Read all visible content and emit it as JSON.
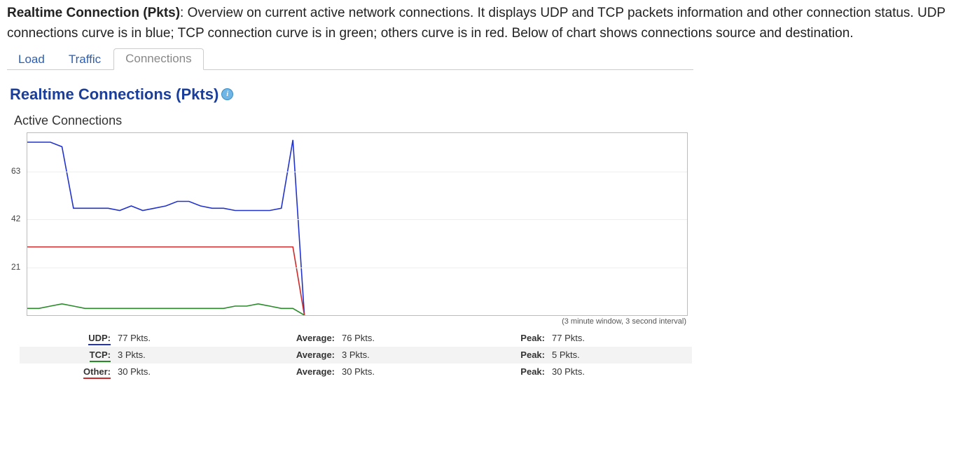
{
  "intro_bold": "Realtime Connection (Pkts)",
  "intro_rest": ": Overview on current active network connections. It displays UDP and TCP packets information and other connection status. UDP connections curve is in blue; TCP connection curve is in green; others curve is in red. Below of chart shows connections source and destination.",
  "tabs": {
    "load": "Load",
    "traffic": "Traffic",
    "connections": "Connections"
  },
  "section_title": "Realtime Connections (Pkts)",
  "sub_title": "Active Connections",
  "chart_note": "(3 minute window, 3 second interval)",
  "yticks": {
    "t1": "21",
    "t2": "42",
    "t3": "63"
  },
  "stats": {
    "avg_label": "Average:",
    "peak_label": "Peak:",
    "rows": [
      {
        "name": "UDP:",
        "color": "#2233cc",
        "cur": "77 Pkts.",
        "avg": "76 Pkts.",
        "peak": "77 Pkts."
      },
      {
        "name": "TCP:",
        "color": "#2a8a2a",
        "cur": "3 Pkts.",
        "avg": "3 Pkts.",
        "peak": "5 Pkts."
      },
      {
        "name": "Other:",
        "color": "#cc2a2a",
        "cur": "30 Pkts.",
        "avg": "30 Pkts.",
        "peak": "30 Pkts."
      }
    ]
  },
  "chart_data": {
    "type": "line",
    "x_description": "time (3-minute window, 3-second interval)",
    "ylabel": "Active Connections (Pkts)",
    "ylim": [
      0,
      80
    ],
    "yticks": [
      21,
      42,
      63
    ],
    "x": [
      0,
      1,
      2,
      3,
      4,
      5,
      6,
      7,
      8,
      9,
      10,
      11,
      12,
      13,
      14,
      15,
      16,
      17,
      18,
      19,
      20,
      21,
      22,
      23,
      24
    ],
    "visible_extent_fraction": 0.42,
    "series": [
      {
        "name": "UDP",
        "color": "#2233cc",
        "values": [
          76,
          76,
          76,
          74,
          47,
          47,
          47,
          47,
          46,
          48,
          46,
          47,
          48,
          50,
          50,
          48,
          47,
          47,
          46,
          46,
          46,
          46,
          47,
          77,
          0
        ]
      },
      {
        "name": "Other",
        "color": "#cc2a2a",
        "values": [
          30,
          30,
          30,
          30,
          30,
          30,
          30,
          30,
          30,
          30,
          30,
          30,
          30,
          30,
          30,
          30,
          30,
          30,
          30,
          30,
          30,
          30,
          30,
          30,
          0
        ]
      },
      {
        "name": "TCP",
        "color": "#2a8a2a",
        "values": [
          3,
          3,
          4,
          5,
          4,
          3,
          3,
          3,
          3,
          3,
          3,
          3,
          3,
          3,
          3,
          3,
          3,
          3,
          4,
          4,
          5,
          4,
          3,
          3,
          0
        ]
      }
    ]
  }
}
